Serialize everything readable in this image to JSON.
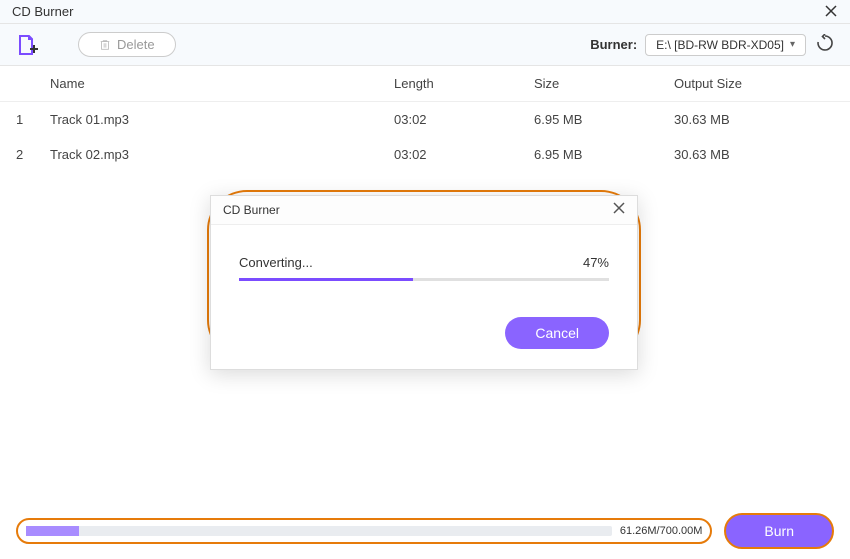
{
  "titlebar": {
    "title": "CD Burner"
  },
  "toolbar": {
    "delete_label": "Delete",
    "burner_label": "Burner:",
    "burner_selected": "E:\\ [BD-RW  BDR-XD05]"
  },
  "table": {
    "headers": {
      "name": "Name",
      "length": "Length",
      "size": "Size",
      "output": "Output Size"
    },
    "rows": [
      {
        "num": "1",
        "name": "Track 01.mp3",
        "length": "03:02",
        "size": "6.95 MB",
        "output": "30.63 MB"
      },
      {
        "num": "2",
        "name": "Track 02.mp3",
        "length": "03:02",
        "size": "6.95 MB",
        "output": "30.63 MB"
      }
    ]
  },
  "modal": {
    "title": "CD Burner",
    "status": "Converting...",
    "percent": "47%",
    "cancel_label": "Cancel"
  },
  "footer": {
    "progress_text": "61.26M/700.00M",
    "burn_label": "Burn"
  }
}
